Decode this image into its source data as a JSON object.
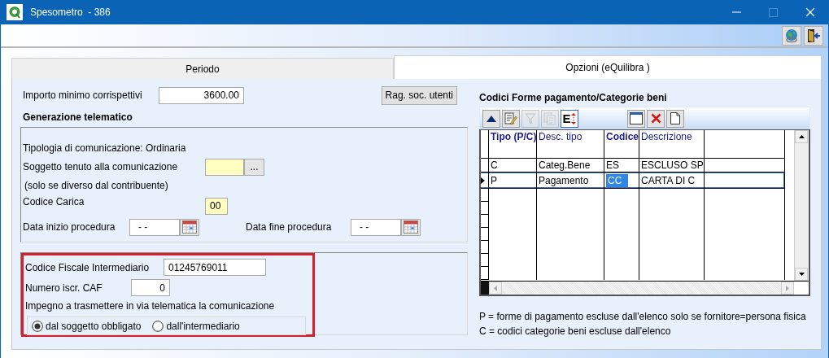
{
  "window": {
    "title": "Spesometro  - 386",
    "maximize_enabled": false
  },
  "tabs": [
    {
      "label": "Periodo",
      "selected": false
    },
    {
      "label": "Opzioni (eQuilibra )",
      "selected": true
    }
  ],
  "importo": {
    "label": "Importo minimo corrispettivi",
    "value": "3600.00"
  },
  "rag_soc_button": "Rag. soc. utenti",
  "generazione": {
    "title": "Generazione telematico",
    "tipologia": "Tipologia di comunicazione: Ordinaria",
    "soggetto": {
      "label": "Soggetto tenuto alla comunicazione",
      "browse": "...",
      "note": "(solo se diverso dal contribuente)"
    },
    "codice_carica": {
      "label": "Codice Carica",
      "value": "00"
    },
    "data_inizio": {
      "label": "Data inizio procedura",
      "value": "- -"
    },
    "data_fine": {
      "label": "Data fine procedura",
      "value": "- -"
    }
  },
  "intermediario": {
    "codice_fiscale": {
      "label": "Codice Fiscale Intermediario",
      "value": "01245769011"
    },
    "numero_caf": {
      "label": "Numero iscr. CAF",
      "value": "0"
    },
    "impegno": "Impegno a trasmettere in via telematica la comunicazione",
    "options": [
      {
        "label": "dal soggetto obbligato",
        "selected": true
      },
      {
        "label": "dall'intermediario",
        "selected": false
      }
    ]
  },
  "codici": {
    "title": "Codici Forme pagamento/Categorie beni",
    "tools_left": [
      {
        "kind": "up",
        "disabled": false
      },
      {
        "kind": "edit",
        "disabled": false
      },
      {
        "kind": "filter",
        "disabled": true
      },
      {
        "kind": "copy",
        "disabled": true
      },
      {
        "kind": "sort",
        "label": "E",
        "disabled": false
      }
    ],
    "tools_right": [
      {
        "kind": "window",
        "disabled": false
      },
      {
        "kind": "delete",
        "disabled": false
      },
      {
        "kind": "new",
        "disabled": false
      }
    ],
    "columns": [
      {
        "label": "Tipo (P/C)",
        "key": true
      },
      {
        "label": "Desc. tipo",
        "key": false
      },
      {
        "label": "Codice",
        "key": true
      },
      {
        "label": "Descrizione",
        "key": false
      }
    ],
    "rows": [
      {
        "selected": false,
        "cells": [
          {
            "text": "C",
            "focused": false
          },
          {
            "text": "Categ.Bene",
            "focused": false
          },
          {
            "text": "ES",
            "focused": false
          },
          {
            "text": "ESCLUSO SP",
            "focused": false
          }
        ]
      },
      {
        "selected": true,
        "cells": [
          {
            "text": "P",
            "focused": false
          },
          {
            "text": "Pagamento",
            "focused": false
          },
          {
            "text": "CC",
            "focused": true
          },
          {
            "text": "CARTA DI C",
            "focused": false
          }
        ]
      }
    ],
    "notes": [
      "P = forme di pagamento escluse dall'elenco solo se fornitore=persona fisica",
      "C = codici categorie beni escluse dall'elenco"
    ]
  }
}
